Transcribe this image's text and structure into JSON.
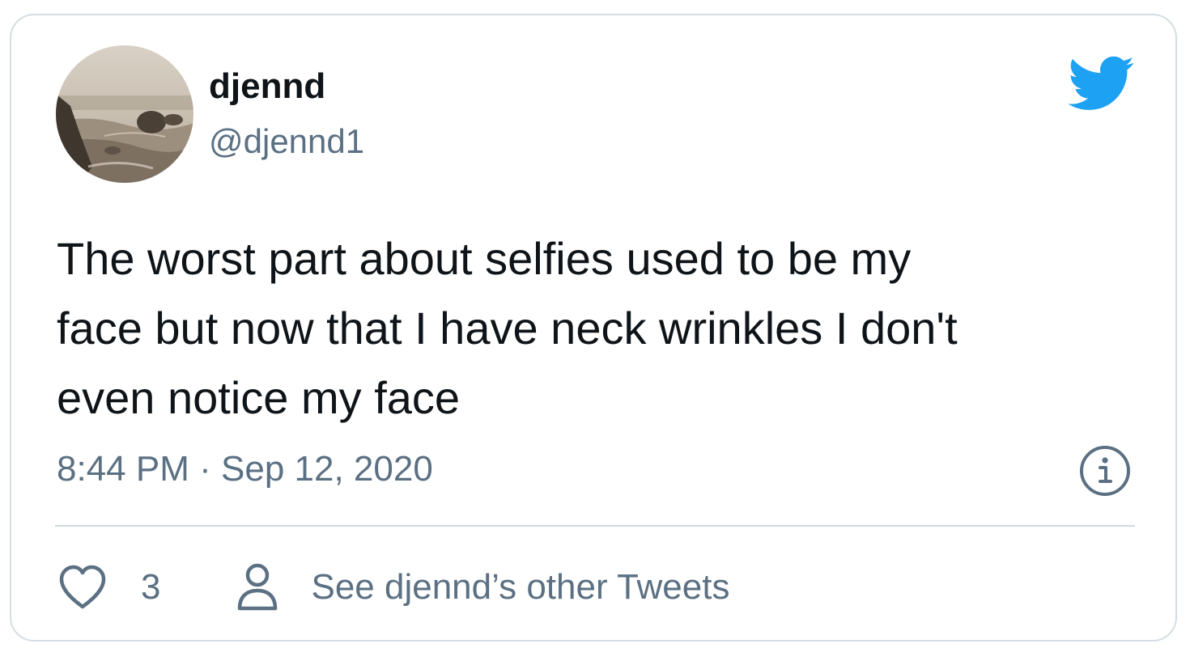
{
  "tweet": {
    "display_name": "djennd",
    "handle": "@djennd1",
    "text": "The worst part about selfies used to be my\nface but now that I have neck wrinkles I don't\neven notice my face",
    "time": "8:44 PM",
    "separator": "·",
    "date": "Sep 12, 2020",
    "likes": "3",
    "other_tweets_label": "See djennd’s other Tweets"
  },
  "icons": {
    "brand": "twitter-bird-icon",
    "info": "info-icon",
    "like": "heart-icon",
    "profile": "user-icon"
  },
  "colors": {
    "twitter_blue": "#1da1f2",
    "secondary_text": "#5b7083",
    "primary_text": "#0f1419",
    "border": "#d5dde3"
  }
}
